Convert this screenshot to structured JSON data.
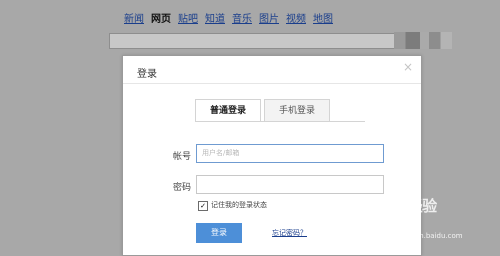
{
  "nav": {
    "items": [
      "新闻",
      "网页",
      "贴吧",
      "知道",
      "音乐",
      "图片",
      "视频",
      "地图"
    ],
    "active": "网页"
  },
  "dialog": {
    "title": "登录",
    "close_glyph": "×",
    "tabs": [
      "普通登录",
      "手机登录"
    ],
    "account_label": "帐号",
    "account_placeholder": "用户名/邮箱",
    "password_label": "密码",
    "remember_label": "记住我的登录状态",
    "remember_checked": true,
    "login_button": "登录",
    "forgot_link": "忘记密码？"
  },
  "watermark": {
    "text": "Baidu经验",
    "url": "jingyan.baidu.com"
  }
}
